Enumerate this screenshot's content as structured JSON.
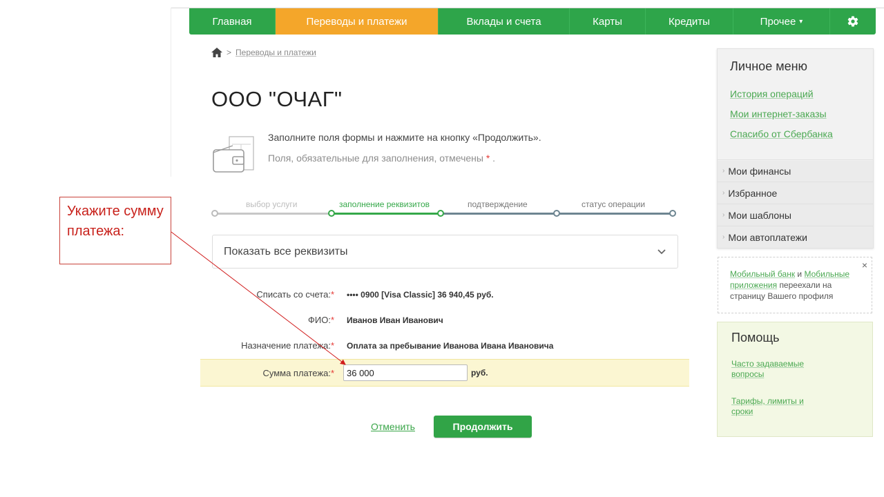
{
  "nav": {
    "items": [
      {
        "label": "Главная"
      },
      {
        "label": "Переводы и платежи"
      },
      {
        "label": "Вклады и счета"
      },
      {
        "label": "Карты"
      },
      {
        "label": "Кредиты"
      },
      {
        "label": "Прочее"
      }
    ],
    "more_caret": "▾",
    "settings_icon": "gear-icon"
  },
  "breadcrumb": {
    "separator": ">",
    "link": "Переводы и платежи"
  },
  "page_title": "ООО \"ОЧАГ\"",
  "intro": {
    "line1": "Заполните поля формы и нажмите на кнопку «Продолжить».",
    "line2_text": "Поля, обязательные для заполнения, отмечены",
    "line2_star": "*",
    "line2_end": "."
  },
  "steps": [
    {
      "label": "выбор услуги",
      "state": "done"
    },
    {
      "label": "заполнение реквизитов",
      "state": "current"
    },
    {
      "label": "подтверждение",
      "state": "pending"
    },
    {
      "label": "статус операции",
      "state": "pending"
    }
  ],
  "details_toggle": "Показать все реквизиты",
  "form": {
    "account_label": "Списать со счета:",
    "account_value": "•••• 0900  [Visa Classic] 36 940,45   руб.",
    "name_label": "ФИО:",
    "name_value": "Иванов Иван Иванович",
    "purpose_label": "Назначение платежа:",
    "purpose_value": "Оплата за пребывание Иванова Ивана Ивановича",
    "amount_label": "Сумма платежа:",
    "amount_value": "36 000",
    "amount_unit": "руб.",
    "required_mark": "*"
  },
  "actions": {
    "cancel": "Отменить",
    "continue": "Продолжить"
  },
  "callout": {
    "text": "Укажите сумму платежа:"
  },
  "sidebar": {
    "menu_title": "Личное меню",
    "links": [
      "История операций",
      "Мои интернет-заказы",
      "Спасибо от Сбербанка"
    ],
    "sections": [
      "Мои финансы",
      "Избранное",
      "Мои шаблоны",
      "Мои автоплатежи"
    ],
    "notice": {
      "link1": "Мобильный банк",
      "and": "и",
      "link2": "Мобильные приложения",
      "rest": "переехали на страницу Вашего профиля",
      "close": "×"
    },
    "help": {
      "title": "Помощь",
      "links": [
        "Часто задаваемые вопросы",
        "Тарифы, лимиты и сроки"
      ]
    }
  },
  "colors": {
    "nav_green": "#2ea54a",
    "nav_active": "#f4a62a",
    "link_green": "#4aa851",
    "callout_red": "#c8211b",
    "highlight_row": "#fbf6d2"
  }
}
